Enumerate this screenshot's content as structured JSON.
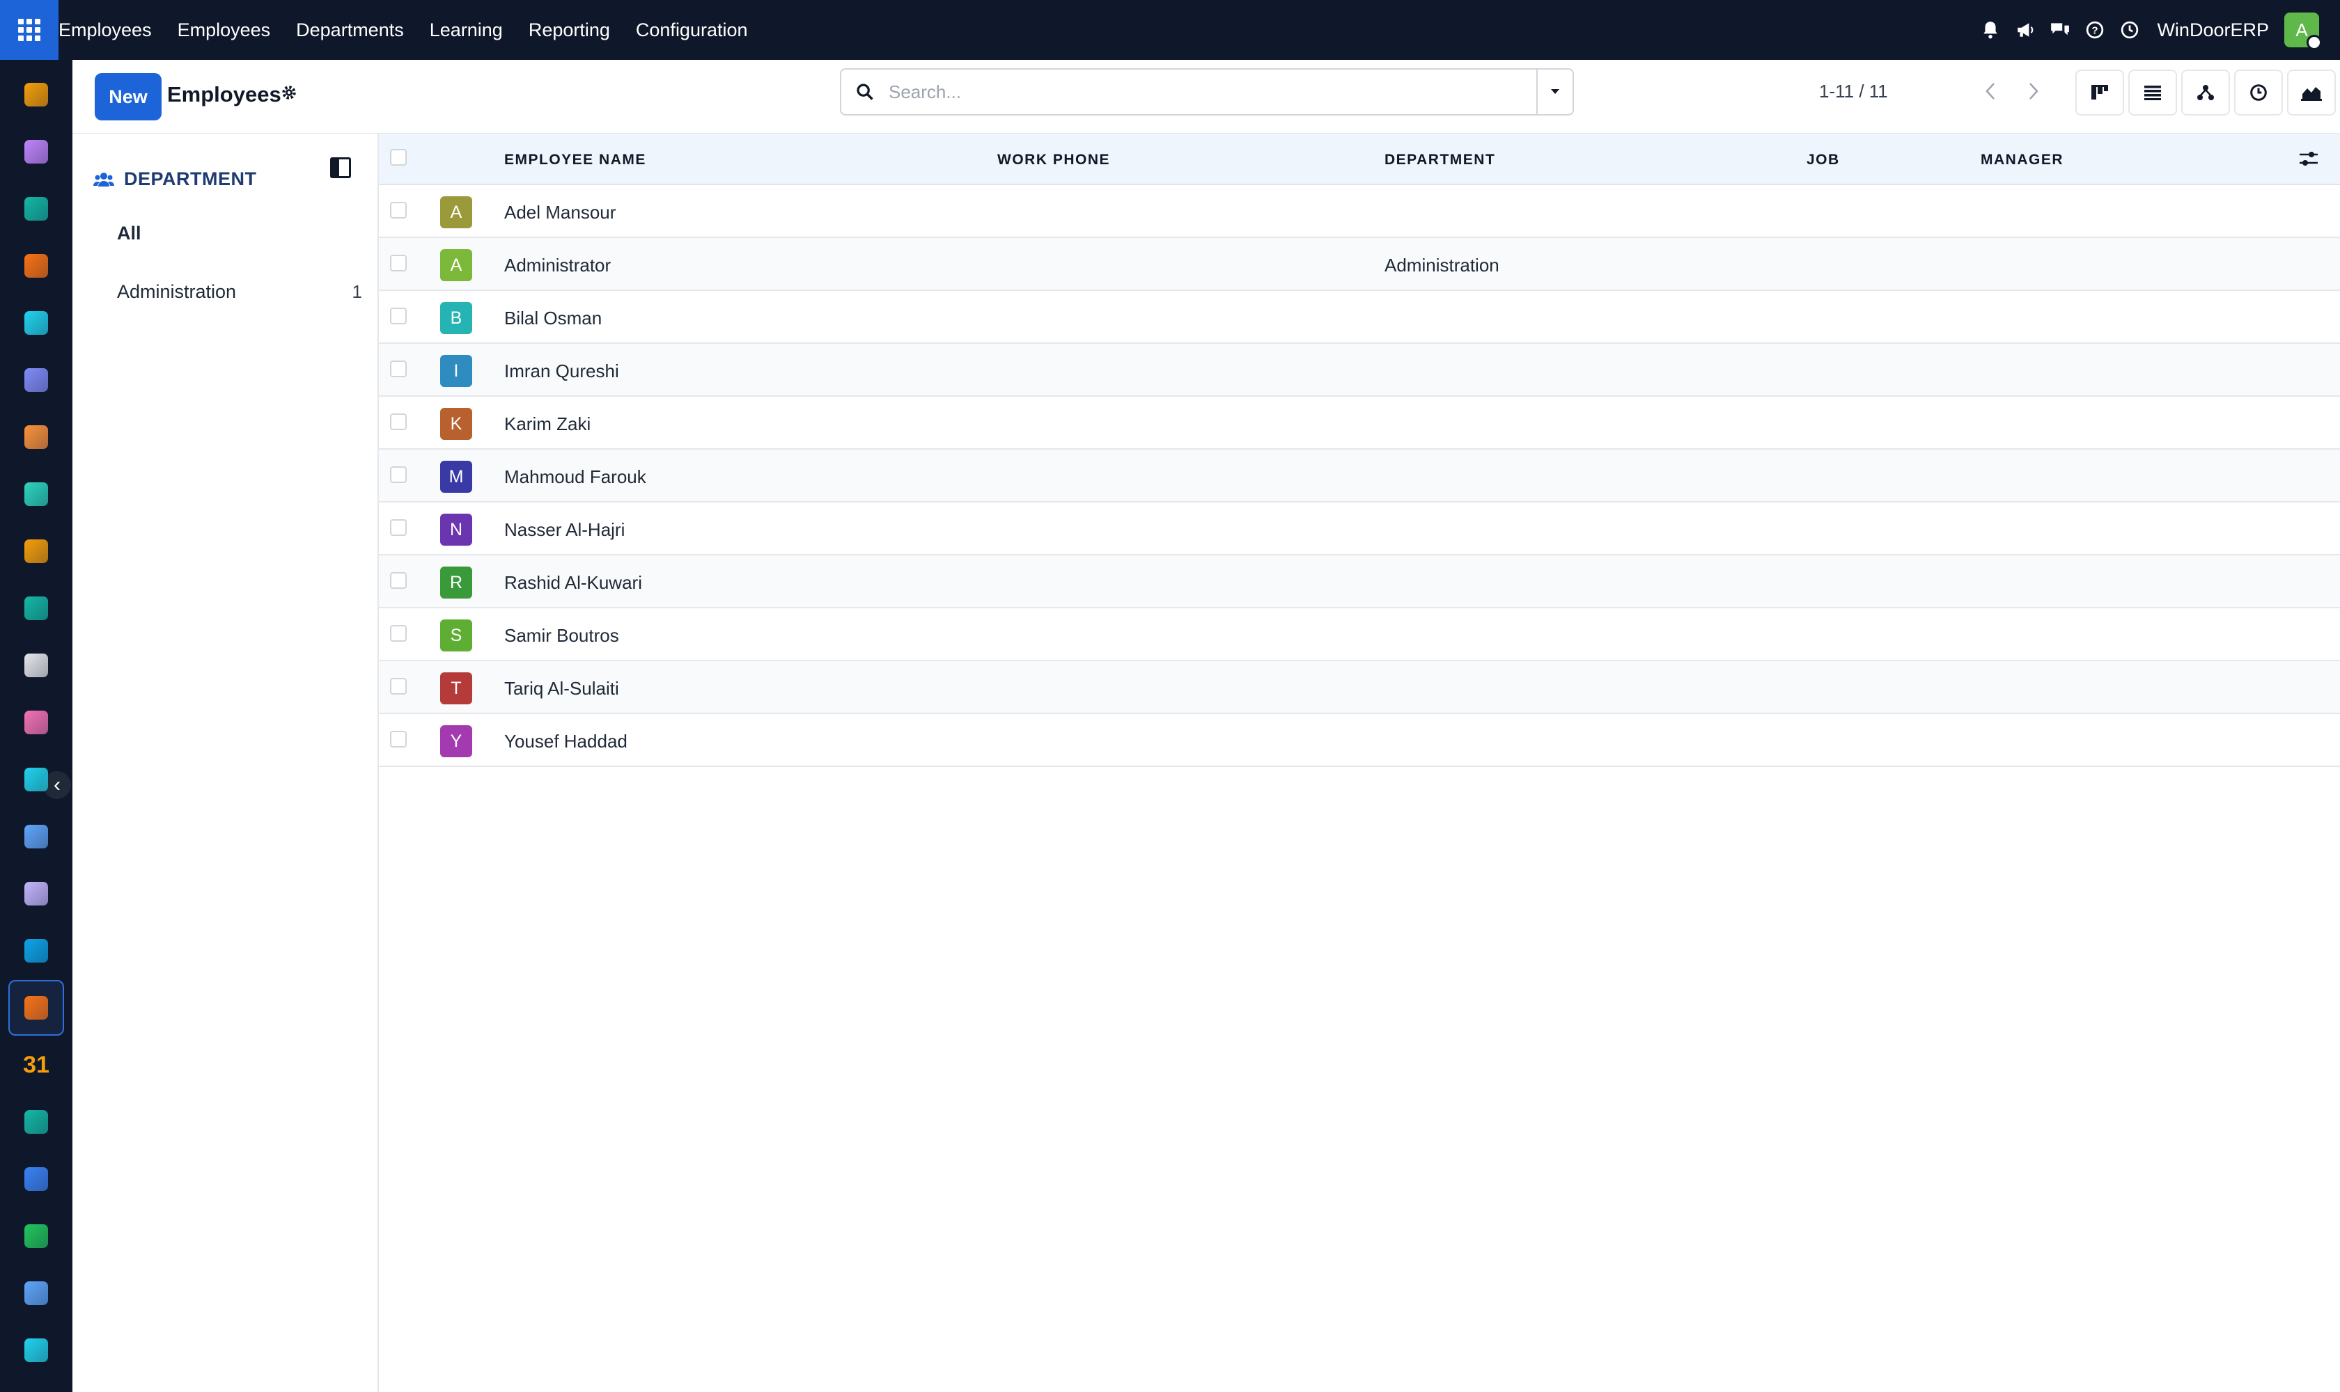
{
  "topbar": {
    "app_name": "Employees",
    "menu": [
      "Employees",
      "Departments",
      "Learning",
      "Reporting",
      "Configuration"
    ],
    "company": "WinDoorERP",
    "user_initial": "A",
    "icons": [
      "bell-icon",
      "megaphone-icon",
      "chat-icon",
      "help-icon",
      "clock-icon"
    ]
  },
  "control": {
    "new_label": "New",
    "title": "Employees",
    "search_placeholder": "Search...",
    "pager": "1-11 / 11",
    "views": [
      "kanban-view-icon",
      "list-view-icon",
      "hierarchy-view-icon",
      "activity-view-icon",
      "graph-view-icon",
      "pivot-view-icon"
    ]
  },
  "panel": {
    "heading": "DEPARTMENT",
    "items": [
      {
        "label": "All",
        "count": ""
      },
      {
        "label": "Administration",
        "count": "1"
      }
    ]
  },
  "table": {
    "headers": {
      "name": "EMPLOYEE NAME",
      "phone": "WORK PHONE",
      "department": "DEPARTMENT",
      "job": "JOB",
      "manager": "MANAGER"
    },
    "rows": [
      {
        "initial": "A",
        "color": "#9a9a3a",
        "name": "Adel Mansour",
        "department": ""
      },
      {
        "initial": "A",
        "color": "#7cb83a",
        "name": "Administrator",
        "department": "Administration"
      },
      {
        "initial": "B",
        "color": "#26b3b3",
        "name": "Bilal Osman",
        "department": ""
      },
      {
        "initial": "I",
        "color": "#2f8cc0",
        "name": "Imran Qureshi",
        "department": ""
      },
      {
        "initial": "K",
        "color": "#b8612f",
        "name": "Karim Zaki",
        "department": ""
      },
      {
        "initial": "M",
        "color": "#3a3aa6",
        "name": "Mahmoud Farouk",
        "department": ""
      },
      {
        "initial": "N",
        "color": "#6b35b0",
        "name": "Nasser Al-Hajri",
        "department": ""
      },
      {
        "initial": "R",
        "color": "#3a9a3a",
        "name": "Rashid Al-Kuwari",
        "department": ""
      },
      {
        "initial": "S",
        "color": "#5fae34",
        "name": "Samir Boutros",
        "department": ""
      },
      {
        "initial": "T",
        "color": "#b53a3a",
        "name": "Tariq Al-Sulaiti",
        "department": ""
      },
      {
        "initial": "Y",
        "color": "#a33ab0",
        "name": "Yousef Haddad",
        "department": ""
      }
    ]
  },
  "sidebar": {
    "apps": [
      {
        "icon": "dashboard-app-icon",
        "color": "#f59e0b"
      },
      {
        "icon": "sales-app-icon",
        "color": "#c084fc"
      },
      {
        "icon": "contacts-app-icon",
        "color": "#14b8a6"
      },
      {
        "icon": "discuss-app-icon",
        "color": "#f97316"
      },
      {
        "icon": "website-app-icon",
        "color": "#22d3ee"
      },
      {
        "icon": "email-app-icon",
        "color": "#818cf8"
      },
      {
        "icon": "livechat-app-icon",
        "color": "#fb923c"
      },
      {
        "icon": "invoicing-app-icon",
        "color": "#2dd4bf"
      },
      {
        "icon": "reporting-app-icon",
        "color": "#f59e0b"
      },
      {
        "icon": "crm-app-icon",
        "color": "#14b8a6"
      },
      {
        "icon": "inventory-app-icon",
        "color": "#e5e7eb"
      },
      {
        "icon": "purchase-app-icon",
        "color": "#f472b6"
      },
      {
        "icon": "project-app-icon",
        "color": "#22d3ee"
      },
      {
        "icon": "knowledge-app-icon",
        "color": "#60a5fa"
      },
      {
        "icon": "products-app-icon",
        "color": "#c4b5fd"
      },
      {
        "icon": "expenses-app-icon",
        "color": "#0ea5e9"
      },
      {
        "icon": "employees-app-icon",
        "color": "#f97316"
      },
      {
        "icon": "calendar-app-icon",
        "color": "#f59e0b"
      },
      {
        "icon": "sign-app-icon",
        "color": "#14b8a6"
      },
      {
        "icon": "dashboards-app-icon",
        "color": "#3b82f6"
      },
      {
        "icon": "whatsapp-app-icon",
        "color": "#22c55e"
      },
      {
        "icon": "timesheets-app-icon",
        "color": "#60a5fa"
      },
      {
        "icon": "website-2-app-icon",
        "color": "#22d3ee"
      }
    ]
  }
}
